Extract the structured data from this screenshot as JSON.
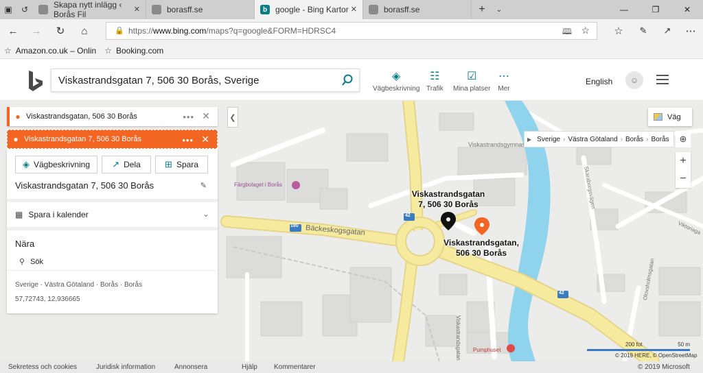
{
  "browser": {
    "tabs": [
      {
        "title": "Skapa nytt inlägg ‹ Borås Fil"
      },
      {
        "title": "borasff.se"
      },
      {
        "title": "google - Bing Kartor",
        "active": true
      },
      {
        "title": "borasff.se"
      }
    ],
    "url": {
      "prefix": "https://",
      "host": "www.bing.com",
      "path": "/maps?q=google&FORM=HDRSC4"
    },
    "favorites": [
      "Amazon.co.uk – Onlin",
      "Booking.com"
    ]
  },
  "header": {
    "search_value": "Viskastrandsgatan 7, 506 30 Borås, Sverige",
    "tools": [
      {
        "label": "Vägbeskrivning",
        "icon": "directions-icon"
      },
      {
        "label": "Trafik",
        "icon": "traffic-icon"
      },
      {
        "label": "Mina platser",
        "icon": "my-places-icon"
      },
      {
        "label": "Mer",
        "icon": "more-icon"
      }
    ],
    "language": "English"
  },
  "panel": {
    "result1": "Viskastrandsgatan, 506 30 Borås",
    "result2": "Viskastrandsgatan 7, 506 30 Borås",
    "buttons": {
      "directions": "Vägbeskrivning",
      "share": "Dela",
      "save": "Spara"
    },
    "address": "Viskastrandsgatan 7, 506 30 Borås",
    "calendar": "Spara i kalender",
    "nearby_title": "Nära",
    "search": "Sök",
    "location_path": "Sverige · Västra Götaland · Borås · Borås",
    "coordinates": "57,72743, 12,936665"
  },
  "map": {
    "style_button": "Väg",
    "breadcrumb": [
      "Sverige",
      "Västra Götaland",
      "Borås",
      "Borås"
    ],
    "pin_label_black": [
      "Viskastrandsgatan",
      "7, 506 30 Borås"
    ],
    "pin_label_orange": [
      "Viskastrandsgatan,",
      "506 30 Borås"
    ],
    "street_labels": {
      "backeskogsgatan": "Bäckeskogsgatan",
      "viskastrandsgatan_v": "Viskastrandsgatan",
      "viskastrandsgymn": "Viskastrandsgymnas",
      "skaraborgsvagen": "Skaraborgsvägen",
      "olovsholmsgatan": "Olovsholmsgatan",
      "viktoriag": "Viktoriaga",
      "road_180": "180",
      "road_42a": "42",
      "road_42b": "42"
    },
    "poi": {
      "fargbolaget": "Färgbolaget i Borås",
      "pumphuset": "Pumphuset"
    },
    "scale": {
      "left": "200 fot",
      "right": "50 m"
    },
    "attribution": "© 2019 HERE, © OpenStreetMap"
  },
  "footer": {
    "links": [
      "Sekretess och cookies",
      "Juridisk information",
      "Annonsera",
      "Hjälp",
      "Kommentarer"
    ],
    "copyright": "© 2019 Microsoft"
  }
}
